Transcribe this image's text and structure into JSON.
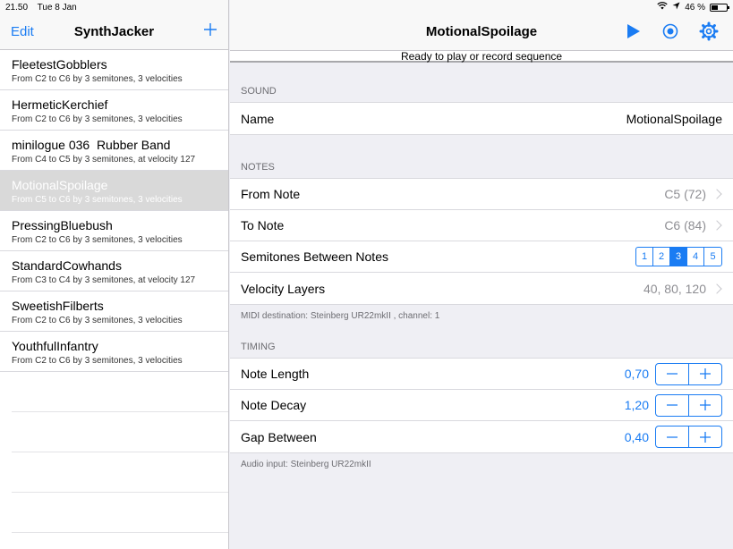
{
  "status_bar": {
    "time": "21.50",
    "date": "Tue 8 Jan",
    "battery": "46 %",
    "battery_level": 0.46
  },
  "master": {
    "edit_label": "Edit",
    "title": "SynthJacker",
    "add_label": "+",
    "items": [
      {
        "name": "FleetestGobblers",
        "detail": "From C2 to C6 by 3 semitones, 3 velocities"
      },
      {
        "name": "HermeticKerchief",
        "detail": "From C2 to C6 by 3 semitones, 3 velocities"
      },
      {
        "name": "minilogue 036  Rubber Band",
        "detail": "From C4 to C5 by 3 semitones, at velocity 127"
      },
      {
        "name": "MotionalSpoilage",
        "detail": "From C5 to C6 by 3 semitones, 3 velocities"
      },
      {
        "name": "PressingBluebush",
        "detail": "From C2 to C6 by 3 semitones, 3 velocities"
      },
      {
        "name": "StandardCowhands",
        "detail": "From C3 to C4 by 3 semitones, at velocity 127"
      },
      {
        "name": "SweetishFilberts",
        "detail": "From C2 to C6 by 3 semitones, 3 velocities"
      },
      {
        "name": "YouthfulInfantry",
        "detail": "From C2 to C6 by 3 semitones, 3 velocities"
      }
    ],
    "selected_index": 3
  },
  "detail": {
    "title": "MotionalSpoilage",
    "status": "Ready to play or record sequence",
    "sound": {
      "header": "SOUND",
      "name_label": "Name",
      "name_value": "MotionalSpoilage"
    },
    "notes": {
      "header": "NOTES",
      "from_label": "From Note",
      "from_value": "C5 (72)",
      "to_label": "To Note",
      "to_value": "C6 (84)",
      "semitones_label": "Semitones Between Notes",
      "semitone_options": [
        "1",
        "2",
        "3",
        "4",
        "5"
      ],
      "semitone_selected": 2,
      "velocity_label": "Velocity Layers",
      "velocity_value": "40, 80, 120",
      "footer": "MIDI destination: Steinberg UR22mkII , channel: 1"
    },
    "timing": {
      "header": "TIMING",
      "length_label": "Note Length",
      "length_value": "0,70",
      "decay_label": "Note Decay",
      "decay_value": "1,20",
      "gap_label": "Gap Between",
      "gap_value": "0,40",
      "footer": "Audio input: Steinberg UR22mkII"
    }
  },
  "colors": {
    "accent": "#1a7cf3",
    "selected_row": "#d9d9d9"
  }
}
